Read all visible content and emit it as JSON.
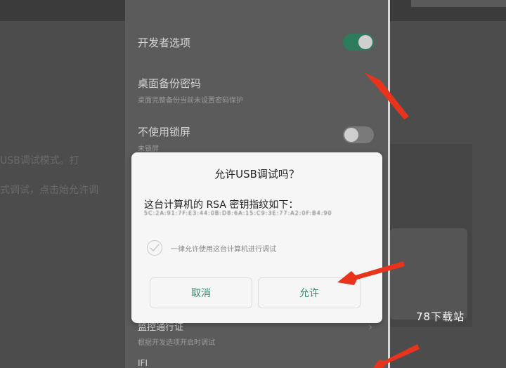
{
  "settings": {
    "developer_options": "开发者选项",
    "desktop_backup_password": {
      "title": "桌面备份密码",
      "subtitle": "桌面完整备份当前未设置密码保护"
    },
    "no_lock_screen": {
      "title": "不使用锁屏",
      "subtitle": "未锁屏"
    },
    "lower_item": {
      "title": "监控通行证",
      "subtitle": "根据开发选项开启时调试"
    },
    "bottom_item": "IFI"
  },
  "background": {
    "line1": "USB调试模式。打",
    "line2": "式调试，点击始允许调"
  },
  "dialog": {
    "title": "允许USB调试吗？",
    "message": "这台计算机的 RSA 密钥指纹如下：",
    "fingerprint": "5C:2A:91:7F:E3:44:0B:D8:6A:15:C9:3E:77:A2:0F:B4:90",
    "always_allow": "一律允许使用这台计算机进行调试",
    "cancel": "取消",
    "allow": "允许"
  },
  "watermark": "78下载站",
  "colors": {
    "accent": "#2e8b65",
    "arrow": "#e8341c"
  }
}
